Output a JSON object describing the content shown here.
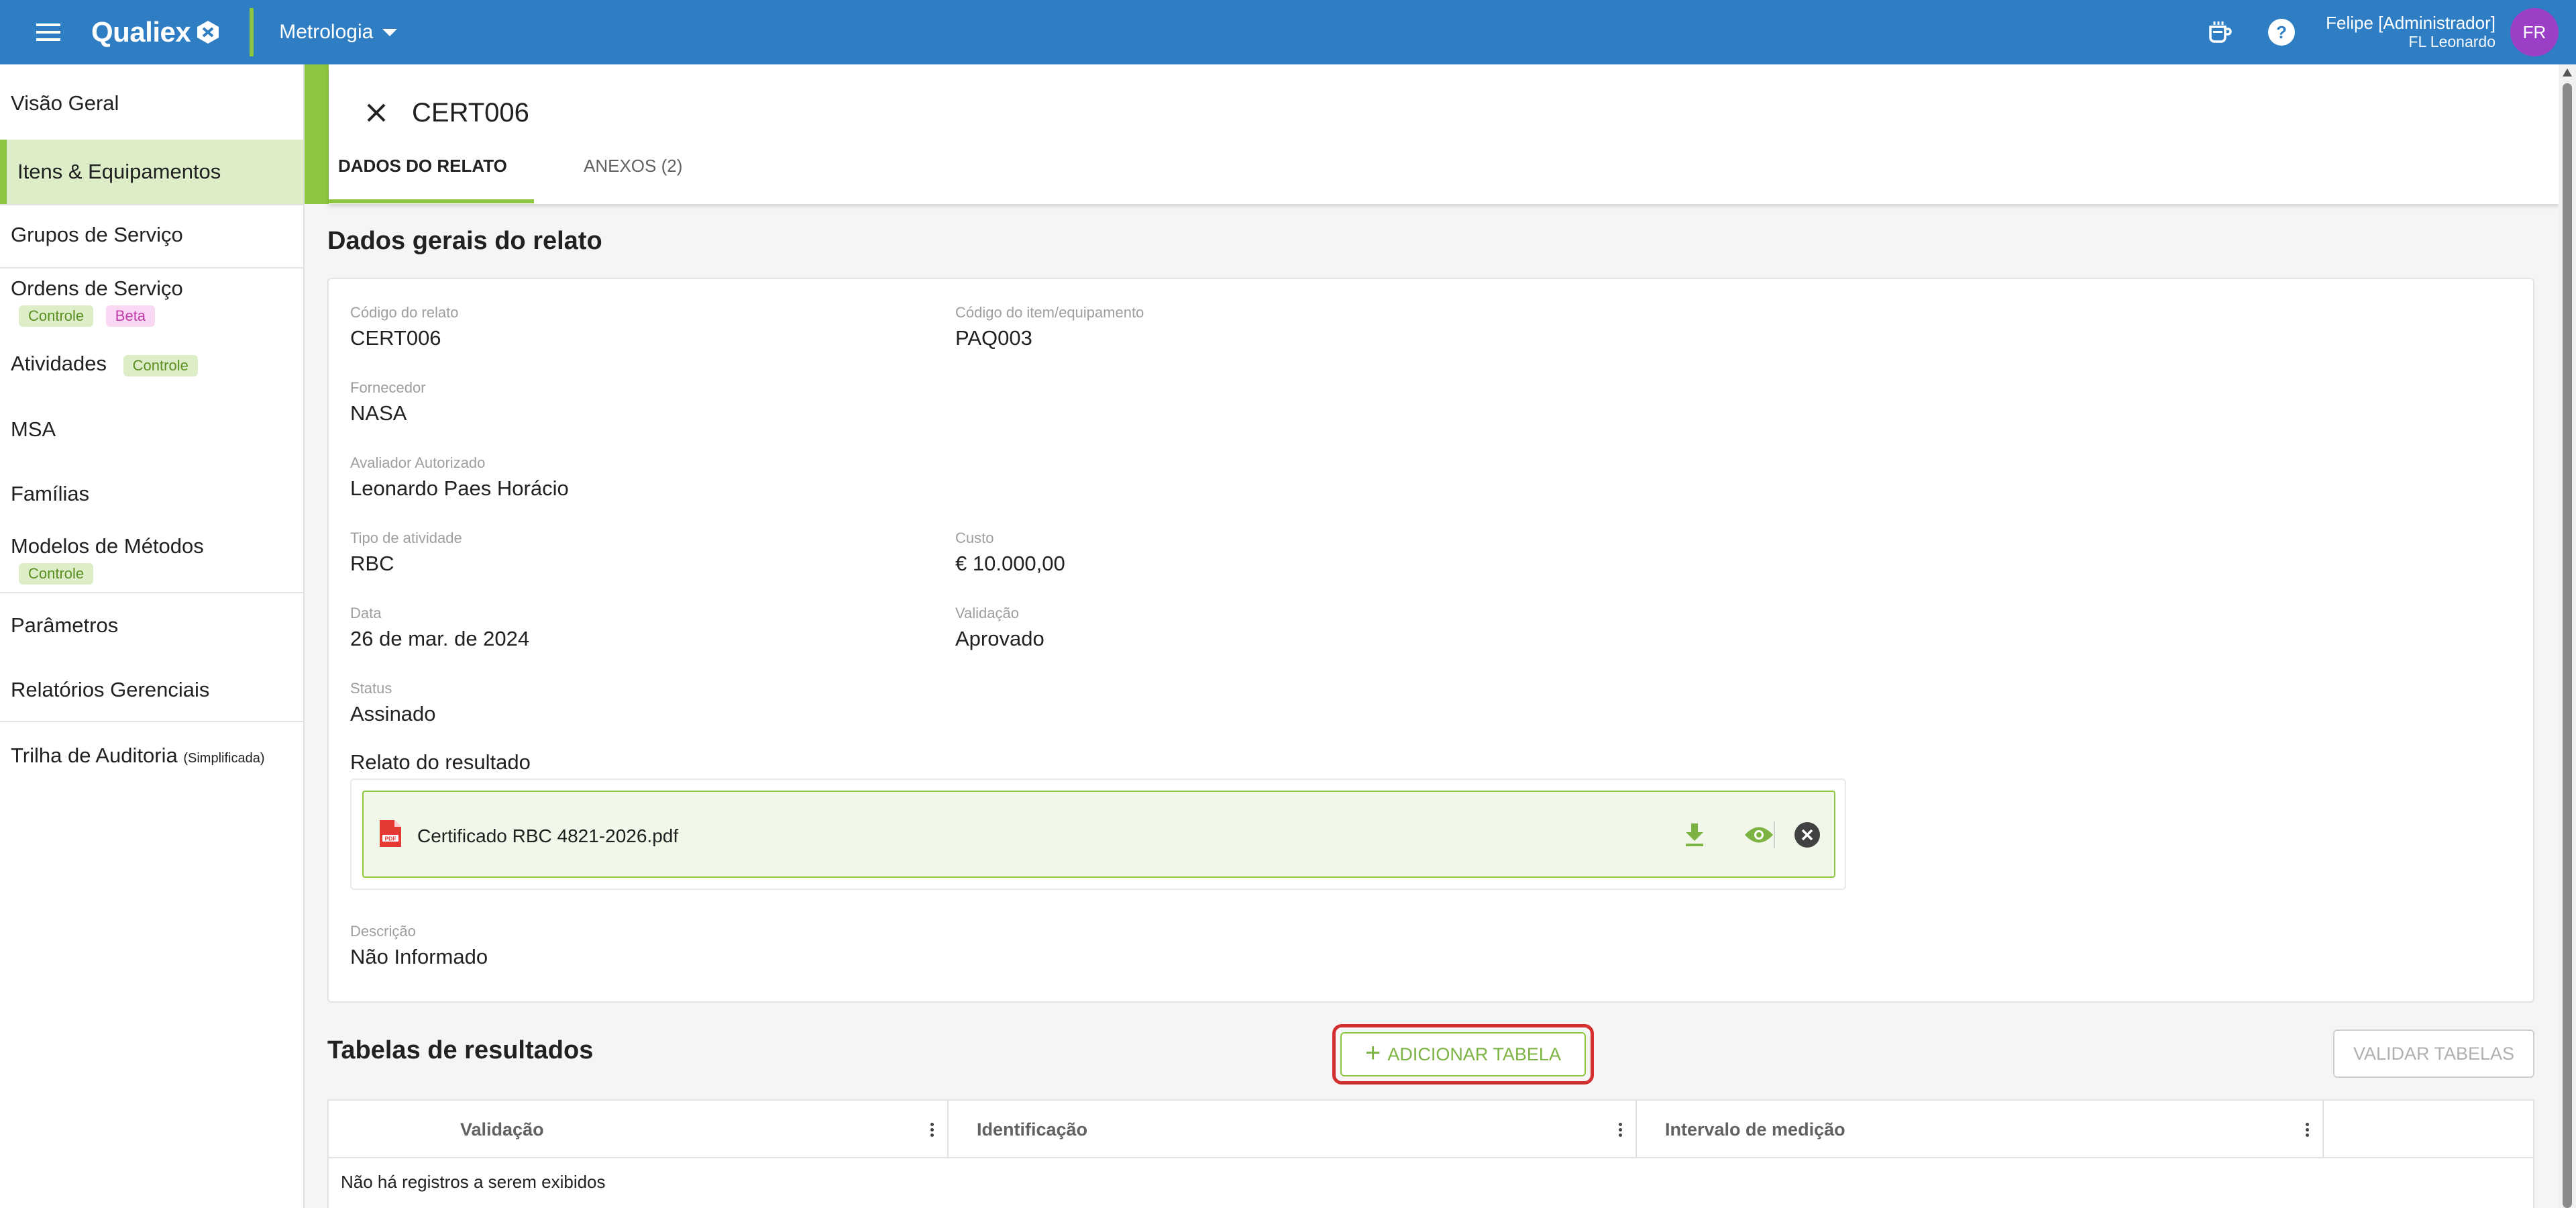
{
  "topbar": {
    "logo_text": "Qualiex",
    "module": "Metrologia",
    "user_name": "Felipe [Administrador]",
    "company": "FL Leonardo",
    "avatar_initials": "FR",
    "icons": [
      "menu-icon",
      "coffee-cup-icon",
      "help-icon",
      "chevron-down-icon"
    ],
    "colors": {
      "bar": "#2f7ec4",
      "accent": "#8cc63f",
      "avatar": "#9c3fc7"
    }
  },
  "sidebar": {
    "items": [
      {
        "label": "Visão Geral"
      },
      {
        "label": "Itens & Equipamentos"
      },
      {
        "label": "Grupos de Serviço"
      },
      {
        "label": "Ordens de Serviço",
        "tags": [
          "Controle",
          "Beta"
        ]
      },
      {
        "label": "Atividades",
        "tags": [
          "Controle"
        ]
      },
      {
        "label": "MSA"
      },
      {
        "label": "Famílias"
      },
      {
        "label": "Modelos de Métodos",
        "tags": [
          "Controle"
        ]
      },
      {
        "label": "Parâmetros"
      },
      {
        "label": "Relatórios Gerenciais"
      },
      {
        "label": "Trilha de Auditoria",
        "suffix": "(Simplificada)"
      }
    ],
    "active_item": "Itens & Equipamentos"
  },
  "header": {
    "title": "CERT006",
    "tabs": [
      {
        "label": "DADOS DO RELATO"
      },
      {
        "label": "ANEXOS (2)"
      }
    ],
    "active_tab": "DADOS DO RELATO"
  },
  "general": {
    "section_title": "Dados gerais do relato",
    "fields": {
      "codigo_relato": {
        "label": "Código do relato",
        "value": "CERT006"
      },
      "codigo_item": {
        "label": "Código do item/equipamento",
        "value": "PAQ003"
      },
      "fornecedor": {
        "label": "Fornecedor",
        "value": "NASA"
      },
      "avaliador": {
        "label": "Avaliador Autorizado",
        "value": "Leonardo Paes Horácio"
      },
      "tipo_atividade": {
        "label": "Tipo de atividade",
        "value": "RBC"
      },
      "custo": {
        "label": "Custo",
        "value": "€ 10.000,00"
      },
      "data": {
        "label": "Data",
        "value": "26 de mar. de 2024"
      },
      "validacao": {
        "label": "Validação",
        "value": "Aprovado"
      },
      "status": {
        "label": "Status",
        "value": "Assinado"
      },
      "descricao": {
        "label": "Descrição",
        "value": "Não Informado"
      }
    },
    "result_label": "Relato do resultado",
    "file": {
      "name": "Certificado RBC 4821-2026.pdf",
      "icon": "pdf-icon",
      "actions": [
        "download-icon",
        "view-icon",
        "remove-icon"
      ]
    }
  },
  "results": {
    "section_title": "Tabelas de resultados",
    "add_button": "ADICIONAR TABELA",
    "validate_button": "VALIDAR TABELAS",
    "columns": [
      "Validação",
      "Identificação",
      "Intervalo de medição"
    ],
    "empty_text": "Não há registros a serem exibidos"
  }
}
